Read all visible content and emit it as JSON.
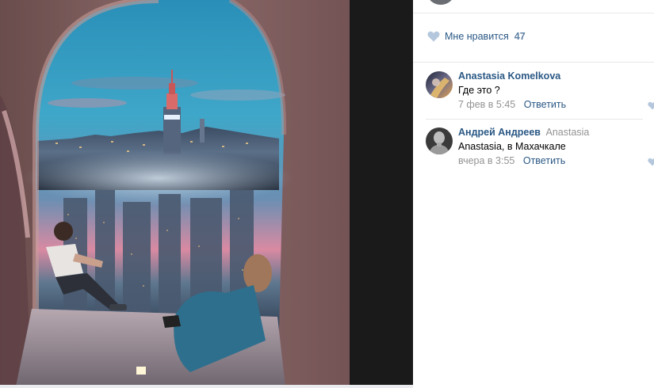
{
  "post": {
    "likes_label": "Мне нравится",
    "likes_count": "47"
  },
  "comments": [
    {
      "author": "Anastasia Komelkova",
      "reply_to": "",
      "text": "Где это ?",
      "date": "7 фев в 5:45",
      "reply_label": "Ответить"
    },
    {
      "author": "Андрей Андреев",
      "reply_to": "Anastasia",
      "text": "Anastasia, в Махачкале",
      "date": "вчера в 3:55",
      "reply_label": "Ответить"
    }
  ],
  "colors": {
    "link": "#2a5885",
    "muted": "#939393",
    "heart": "#b4c7dc",
    "divider": "#e7e8ec"
  }
}
